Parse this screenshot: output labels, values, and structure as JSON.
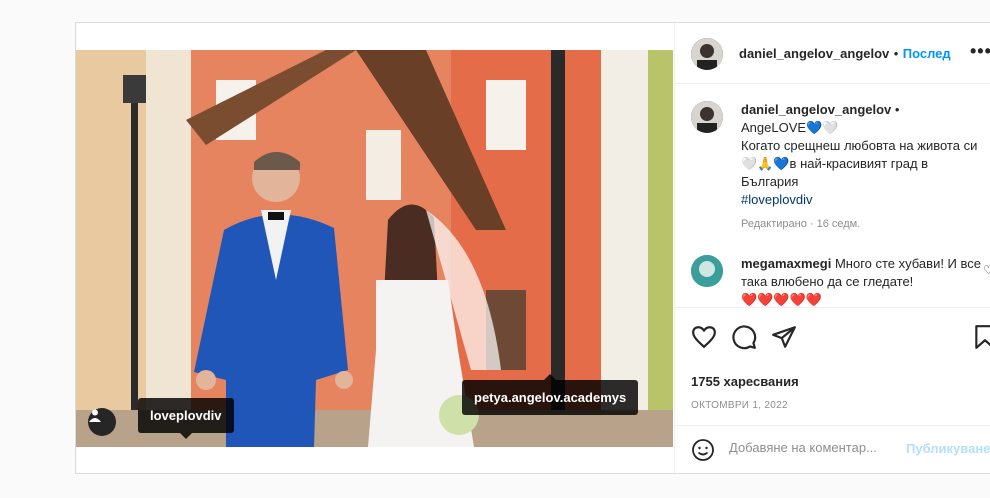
{
  "header": {
    "username": "daniel_angelov_angelov",
    "separator": "•",
    "follow_label": "Послед",
    "more_label": "•••"
  },
  "caption": {
    "username": "daniel_angelov_angelov",
    "separator": "•",
    "line1": "AngeLOVE💙🤍",
    "line2": "Когато срещнеш любовта на живота си 🤍🙏💙в най-красивият град в България",
    "hashtag": "#loveplovdiv",
    "edited": "Редактирано · 16 седм."
  },
  "comment": {
    "username": "megamaxmegi",
    "text": "Много сте хубави! И все така влюбено да се гледате!",
    "emoji": "❤️❤️❤️❤️❤️"
  },
  "media": {
    "tags": [
      "loveplovdiv",
      "petya.angelov.academys"
    ]
  },
  "actions": {
    "likes": "1755 харесвания",
    "date": "ОКТОМВРИ 1, 2022"
  },
  "add_comment": {
    "placeholder": "Добавяне на коментар...",
    "publish_label": "Публикуване"
  },
  "colors": {
    "accent": "#0095f6",
    "publish_disabled": "#b2dffc",
    "muted": "#8e8e8e"
  }
}
